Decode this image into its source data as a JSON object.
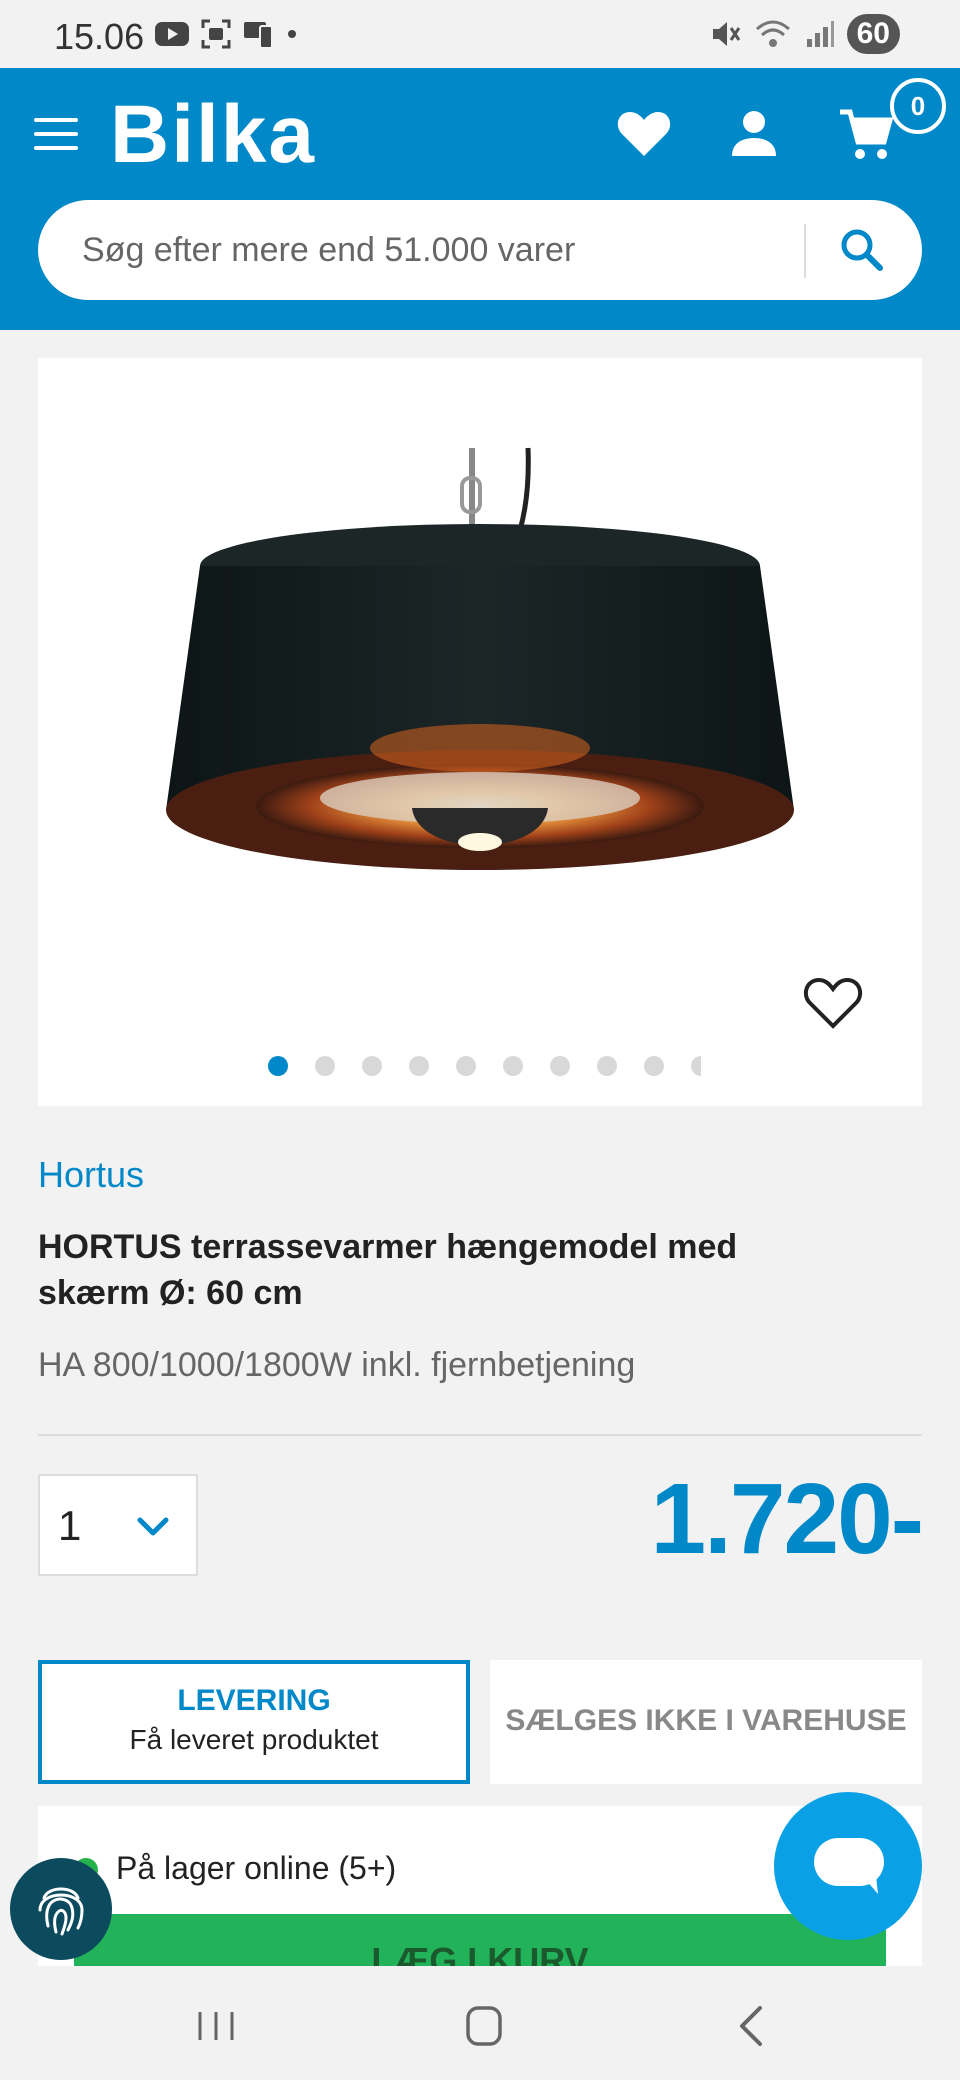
{
  "status": {
    "time": "15.06",
    "battery": "60"
  },
  "header": {
    "logo": "Bilka",
    "cart_count": "0",
    "search_placeholder": "Søg efter mere end 51.000 varer"
  },
  "gallery": {
    "image_count": 10,
    "active_index": 0
  },
  "product": {
    "brand": "Hortus",
    "title": "HORTUS terrassevarmer hængemodel med skærm Ø: 60 cm",
    "subtitle": "HA 800/1000/1800W inkl. fjernbetjening",
    "quantity": "1",
    "price": "1.720-"
  },
  "tabs": {
    "delivery_title": "LEVERING",
    "delivery_sub": "Få leveret produktet",
    "store_title": "SÆLGES IKKE I VAREHUSE"
  },
  "stock": {
    "text": "På lager online (5+)",
    "button_label": "LÆG I KURV"
  },
  "colors": {
    "brand_blue": "#0088c9",
    "stock_green": "#26b24a",
    "cart_green": "#22b25a"
  }
}
